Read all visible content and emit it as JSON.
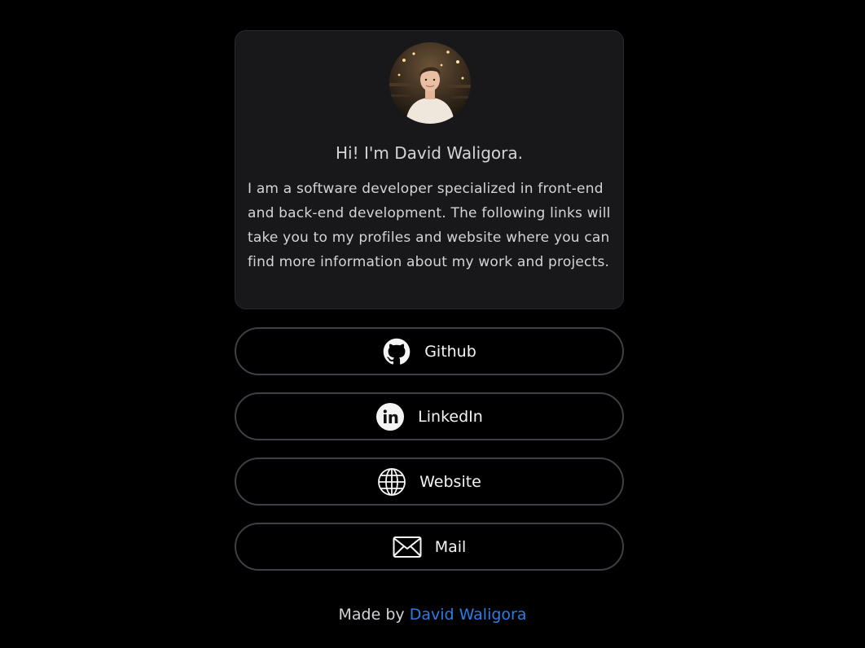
{
  "profile": {
    "greeting": "Hi! I'm David Waligora.",
    "bio": "I am a software developer specialized in front-end and back-end development. The following links will take you to my profiles and website where you can find more information about my work and projects."
  },
  "links": [
    {
      "label": "Github",
      "icon": "github-icon"
    },
    {
      "label": "LinkedIn",
      "icon": "linkedin-icon"
    },
    {
      "label": "Website",
      "icon": "globe-icon"
    },
    {
      "label": "Mail",
      "icon": "mail-icon"
    }
  ],
  "footer": {
    "prefix": "Made by",
    "author_link": "David Waligora"
  },
  "colors": {
    "background": "#000000",
    "card": "#18181b",
    "border": "#3f3f46",
    "accent_link": "#2b7de9"
  }
}
